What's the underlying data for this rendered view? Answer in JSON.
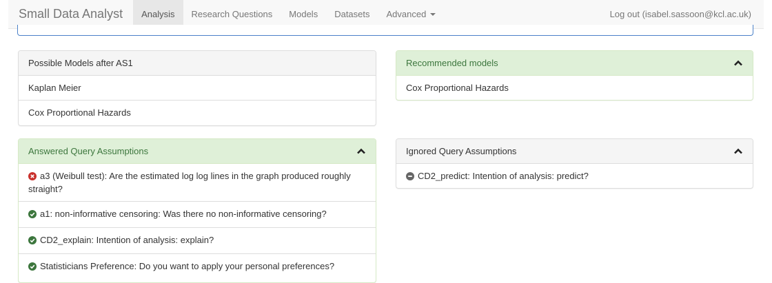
{
  "navbar": {
    "brand": "Small Data Analyst",
    "tabs": [
      "Analysis",
      "Research Questions",
      "Models",
      "Datasets",
      "Advanced"
    ],
    "active_tab": "Analysis",
    "logout": "Log out (isabel.sassoon@kcl.ac.uk)"
  },
  "panels": {
    "possible": {
      "title": "Possible Models after AS1",
      "items": [
        "Kaplan Meier",
        "Cox Proportional Hazards"
      ]
    },
    "recommended": {
      "title": "Recommended models",
      "items": [
        "Cox Proportional Hazards"
      ]
    },
    "answered": {
      "title": "Answered Query Assumptions",
      "items": [
        {
          "status": "failed",
          "text": "a3 (Weibull test): Are the estimated log log lines in the graph produced roughly straight?"
        },
        {
          "status": "passed",
          "text": "a1: non-informative censoring: Was there no non-informative censoring?"
        },
        {
          "status": "passed",
          "text": "CD2_explain: Intention of analysis: explain?"
        },
        {
          "status": "passed",
          "text": "Statisticians Preference: Do you want to apply your personal preferences?"
        }
      ]
    },
    "ignored": {
      "title": "Ignored Query Assumptions",
      "items": [
        {
          "status": "ignored",
          "text": "CD2_predict: Intention of analysis: predict?"
        }
      ]
    }
  },
  "colors": {
    "success": "#3c763d",
    "danger": "#c9302c",
    "ignored": "#666666",
    "green_heading": "#dff0d8",
    "accent_border": "#4a80c8"
  },
  "icons": {
    "passed": "check-circle-icon",
    "failed": "times-circle-icon",
    "ignored": "minus-circle-icon",
    "collapse": "chevron-up-icon",
    "dropdown": "caret-down-icon"
  }
}
